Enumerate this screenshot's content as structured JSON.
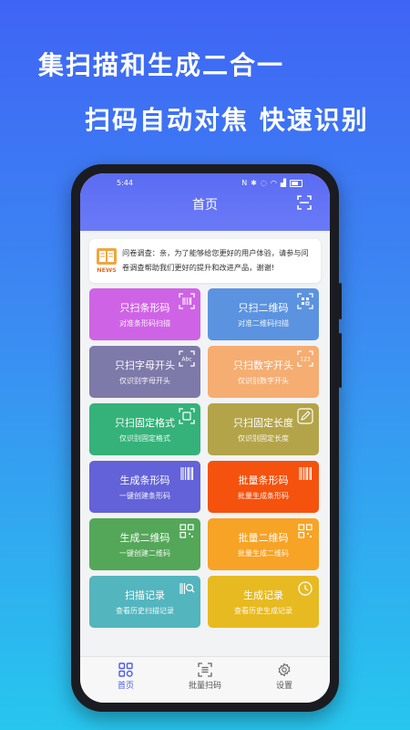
{
  "headlines": {
    "line1": "集扫描和生成二合一",
    "line2": "扫码自动对焦 快速识别"
  },
  "status_bar": {
    "time": "5:44"
  },
  "header": {
    "title": "首页"
  },
  "notice": {
    "icon_label": "NEWS",
    "text": "问卷调查：亲，为了能够给您更好的用户体验，请参与问卷调查帮助我们更好的提升和改进产品，谢谢!"
  },
  "cards": [
    {
      "title": "只扫条形码",
      "subtitle": "对准条形码扫描",
      "icon": "barcode-scan-icon",
      "color": "#cf63e6"
    },
    {
      "title": "只扫二维码",
      "subtitle": "对准二维码扫描",
      "icon": "qr-scan-icon",
      "color": "#5b93e0"
    },
    {
      "title": "只扫字母开头",
      "subtitle": "仅识别字母开头",
      "icon": "abc-icon",
      "icon_text": "Abc",
      "color": "#7d79a9"
    },
    {
      "title": "只扫数字开头",
      "subtitle": "仅识别数字开头",
      "icon": "digits-icon",
      "icon_text": "123",
      "color": "#f5ad72"
    },
    {
      "title": "只扫固定格式",
      "subtitle": "仅识别固定格式",
      "icon": "format-scan-icon",
      "color": "#34b27a"
    },
    {
      "title": "只扫固定长度",
      "subtitle": "仅识别固定长度",
      "icon": "pencil-icon",
      "color": "#b3a449"
    },
    {
      "title": "生成条形码",
      "subtitle": "一键创建条形码",
      "icon": "barcode-icon",
      "color": "#6362d8"
    },
    {
      "title": "批量条形码",
      "subtitle": "批量生成条形码",
      "icon": "barcode-icon",
      "color": "#f5520e"
    },
    {
      "title": "生成二维码",
      "subtitle": "一键创建二维码",
      "icon": "qr-code-icon",
      "color": "#54a758"
    },
    {
      "title": "批量二维码",
      "subtitle": "批量生成二维码",
      "icon": "qr-code-icon",
      "color": "#f7a326"
    },
    {
      "title": "扫描记录",
      "subtitle": "查看历史扫描记录",
      "icon": "scan-history-icon",
      "color": "#53b5be"
    },
    {
      "title": "生成记录",
      "subtitle": "查看历史生成记录",
      "icon": "clock-icon",
      "color": "#e8ba21"
    }
  ],
  "tabs": [
    {
      "label": "首页",
      "icon": "home-grid-icon",
      "active": true
    },
    {
      "label": "批量扫码",
      "icon": "batch-scan-icon",
      "active": false
    },
    {
      "label": "设置",
      "icon": "gear-icon",
      "active": false
    }
  ],
  "colors": {
    "accent": "#4b5de8",
    "header": "#5f70f5"
  }
}
